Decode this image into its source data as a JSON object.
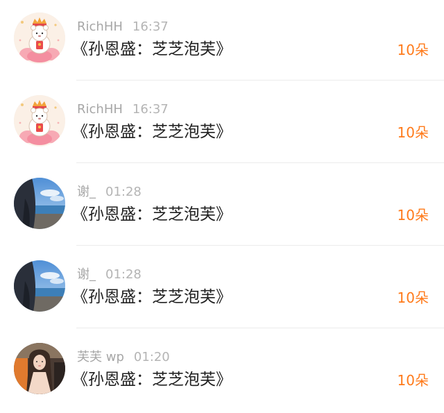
{
  "comments": [
    {
      "user": "RichHH",
      "time": "16:37",
      "message": "《孙恩盛：芝芝泡芙》",
      "gift": "10朵",
      "avatar_icon": "cartoon-bear-on-lotus-avatar"
    },
    {
      "user": "RichHH",
      "time": "16:37",
      "message": "《孙恩盛：芝芝泡芙》",
      "gift": "10朵",
      "avatar_icon": "cartoon-bear-on-lotus-avatar"
    },
    {
      "user": "谢_",
      "time": "01:28",
      "message": "《孙恩盛：芝芝泡芙》",
      "gift": "10朵",
      "avatar_icon": "seaside-photo-avatar"
    },
    {
      "user": "谢_",
      "time": "01:28",
      "message": "《孙恩盛：芝芝泡芙》",
      "gift": "10朵",
      "avatar_icon": "seaside-photo-avatar"
    },
    {
      "user": "芙芙 wp",
      "time": "01:20",
      "message": "《孙恩盛：芝芝泡芙》",
      "gift": "10朵",
      "avatar_icon": "girl-in-car-photo-avatar"
    }
  ],
  "colors": {
    "gift_accent": "#ff7a1a",
    "username": "#a7a7a7",
    "timestamp": "#b4b4b4",
    "message_text": "#222222",
    "divider": "#ececec"
  }
}
